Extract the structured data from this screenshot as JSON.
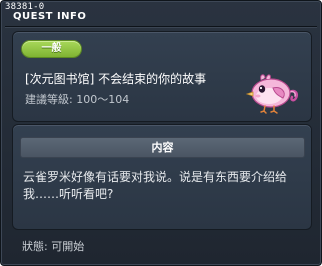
{
  "window": {
    "quest_id": "38381-0",
    "title": "QUEST INFO"
  },
  "quest": {
    "category_badge": "一般",
    "name": "[次元图书馆] 不会结束的你的故事",
    "level_requirement": "建議等級: 100～104",
    "icon": "pink-bird-icon"
  },
  "content": {
    "header": "内容",
    "text": "云雀罗米好像有话要对我说。说是有东西要介绍给我……听听看吧?"
  },
  "status": {
    "label": "狀態:  可開始"
  },
  "colors": {
    "badge_green": "#8fc441",
    "panel_bg": "#303c4b",
    "window_bg": "#262e39"
  }
}
